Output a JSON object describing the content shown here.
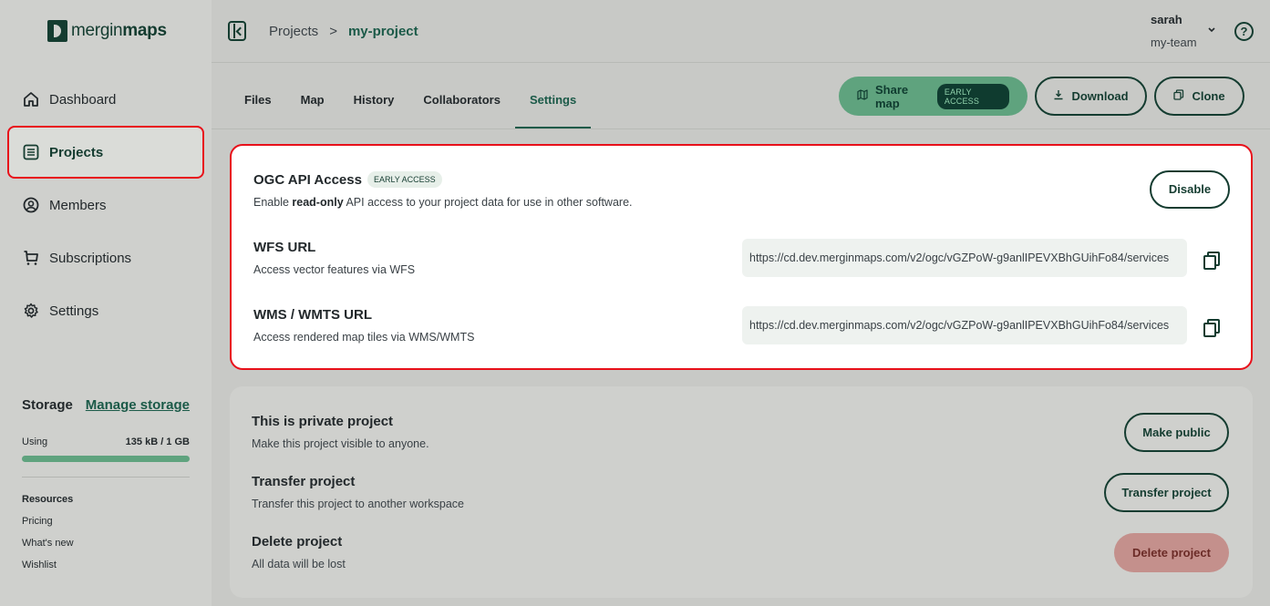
{
  "logo": {
    "text_light": "mergin",
    "text_bold": "maps"
  },
  "sidebar": {
    "items": [
      {
        "label": "Dashboard",
        "icon": "home-icon"
      },
      {
        "label": "Projects",
        "icon": "list-icon",
        "active": true
      },
      {
        "label": "Members",
        "icon": "user-circle-icon"
      },
      {
        "label": "Subscriptions",
        "icon": "cart-icon"
      },
      {
        "label": "Settings",
        "icon": "gear-icon"
      }
    ],
    "storage": {
      "title": "Storage",
      "manage_label": "Manage storage",
      "using_label": "Using",
      "using_value": "135 kB / 1 GB"
    },
    "resources": {
      "title": "Resources",
      "links": [
        "Pricing",
        "What's new",
        "Wishlist"
      ]
    }
  },
  "header": {
    "breadcrumb": {
      "root": "Projects",
      "separator": ">",
      "current": "my-project"
    },
    "user": {
      "name": "sarah",
      "team": "my-team"
    },
    "help_symbol": "?"
  },
  "tabs": [
    "Files",
    "Map",
    "History",
    "Collaborators",
    "Settings"
  ],
  "active_tab": "Settings",
  "actions": {
    "share_label": "Share map",
    "share_badge": "EARLY ACCESS",
    "download_label": "Download",
    "clone_label": "Clone"
  },
  "ogc": {
    "title": "OGC API Access",
    "badge": "EARLY ACCESS",
    "desc_pre": "Enable ",
    "desc_bold": "read-only",
    "desc_post": " API access to your project data for use in other software.",
    "disable_label": "Disable",
    "wfs": {
      "title": "WFS URL",
      "desc": "Access vector features via WFS",
      "url": "https://cd.dev.merginmaps.com/v2/ogc/vGZPoW-g9anlIPEVXBhGUihFo84/services"
    },
    "wms": {
      "title": "WMS / WMTS URL",
      "desc": "Access rendered map tiles via WMS/WMTS",
      "url": "https://cd.dev.merginmaps.com/v2/ogc/vGZPoW-g9anlIPEVXBhGUihFo84/services"
    }
  },
  "project_settings": {
    "private": {
      "title": "This is private project",
      "desc": "Make this project visible to anyone.",
      "button": "Make public"
    },
    "transfer": {
      "title": "Transfer project",
      "desc": "Transfer this project to another workspace",
      "button": "Transfer project"
    },
    "delete": {
      "title": "Delete project",
      "desc": "All data will be lost",
      "button": "Delete project"
    }
  },
  "colors": {
    "brand_dark": "#143c30",
    "brand_green": "#5fa37e",
    "highlight_red": "#e8101a",
    "danger_bg": "#c4908c"
  }
}
